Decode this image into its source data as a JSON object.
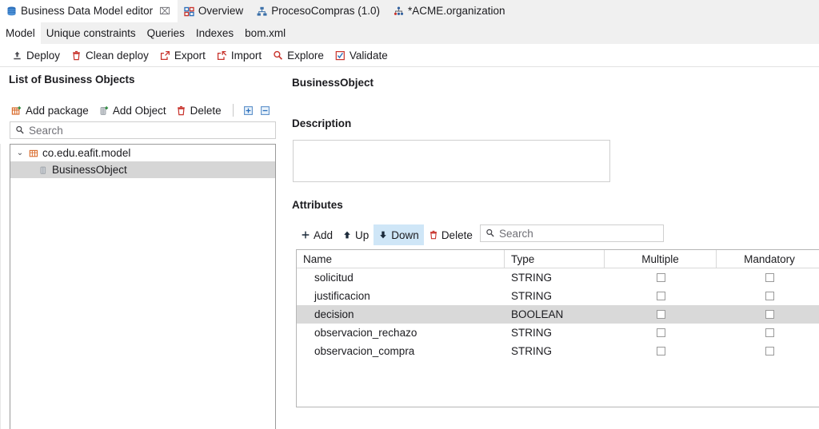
{
  "tabs": [
    {
      "label": "Business Data Model editor",
      "icon": "database-stack-icon",
      "active": true,
      "closable": true,
      "close_glyph": "⌧"
    },
    {
      "label": "Overview",
      "icon": "grid-squares-icon",
      "active": false,
      "closable": false
    },
    {
      "label": "ProcesoCompras (1.0)",
      "icon": "process-diagram-icon",
      "active": false,
      "closable": false
    },
    {
      "label": "*ACME.organization",
      "icon": "organization-icon",
      "active": false,
      "closable": false
    }
  ],
  "menu": {
    "items": [
      {
        "label": "Model",
        "active": true
      },
      {
        "label": "Unique constraints",
        "active": false
      },
      {
        "label": "Queries",
        "active": false
      },
      {
        "label": "Indexes",
        "active": false
      },
      {
        "label": "bom.xml",
        "active": false
      }
    ]
  },
  "toolbar": {
    "buttons": [
      {
        "label": "Deploy",
        "icon": "deploy-upload-icon"
      },
      {
        "label": "Clean deploy",
        "icon": "trash-icon"
      },
      {
        "label": "Export",
        "icon": "export-arrow-icon"
      },
      {
        "label": "Import",
        "icon": "import-arrow-icon"
      },
      {
        "label": "Explore",
        "icon": "magnifier-icon"
      },
      {
        "label": "Validate",
        "icon": "checkbox-checked-icon"
      }
    ]
  },
  "left_panel": {
    "title": "List of Business Objects",
    "buttons": [
      {
        "label": "Add package",
        "icon": "package-add-icon"
      },
      {
        "label": "Add Object",
        "icon": "object-add-icon"
      },
      {
        "label": "Delete",
        "icon": "trash-icon"
      }
    ],
    "icon_buttons": [
      {
        "name": "expand-all-icon",
        "glyph": "+"
      },
      {
        "name": "collapse-all-icon",
        "glyph": "−"
      }
    ],
    "search": {
      "placeholder": "Search",
      "value": "",
      "icon": "search-icon"
    },
    "tree": [
      {
        "label": "co.edu.eafit.model",
        "icon": "package-icon",
        "level": 0,
        "expanded": true,
        "twisty": "⌄",
        "selected": false
      },
      {
        "label": "BusinessObject",
        "icon": "business-object-icon",
        "level": 1,
        "expanded": false,
        "twisty": "",
        "selected": true
      }
    ]
  },
  "right_panel": {
    "object_title": "BusinessObject",
    "description_label": "Description",
    "description_value": "",
    "attributes_label": "Attributes",
    "attr_buttons": [
      {
        "label": "Add",
        "icon": "plus-icon",
        "hover": false
      },
      {
        "label": "Up",
        "icon": "arrow-up-icon",
        "hover": false
      },
      {
        "label": "Down",
        "icon": "arrow-down-icon",
        "hover": true
      },
      {
        "label": "Delete",
        "icon": "trash-icon",
        "hover": false
      }
    ],
    "attr_search": {
      "placeholder": "Search",
      "value": "",
      "icon": "search-icon"
    },
    "table": {
      "columns": [
        "Name",
        "Type",
        "Multiple",
        "Mandatory"
      ],
      "rows": [
        {
          "name": "solicitud",
          "type": "STRING",
          "multiple": false,
          "mandatory": false,
          "selected": false
        },
        {
          "name": "justificacion",
          "type": "STRING",
          "multiple": false,
          "mandatory": false,
          "selected": false
        },
        {
          "name": "decision",
          "type": "BOOLEAN",
          "multiple": false,
          "mandatory": false,
          "selected": true
        },
        {
          "name": "observacion_rechazo",
          "type": "STRING",
          "multiple": false,
          "mandatory": false,
          "selected": false
        },
        {
          "name": "observacion_compra",
          "type": "STRING",
          "multiple": false,
          "mandatory": false,
          "selected": false
        }
      ]
    }
  },
  "colors": {
    "accent_blue": "#2a6ebb",
    "accent_red": "#c8332c",
    "selection_gray": "#d6d6d6",
    "hover_blue": "#cfe6f7",
    "chrome_gray": "#f0f0f0"
  }
}
